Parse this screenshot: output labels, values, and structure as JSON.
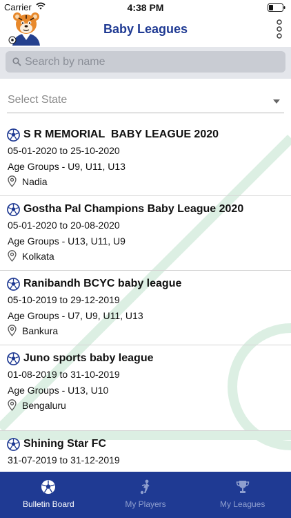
{
  "status_bar": {
    "carrier": "Carrier",
    "time": "4:38 PM"
  },
  "header": {
    "title": "Baby Leagues"
  },
  "search": {
    "placeholder": "Search by name"
  },
  "state_filter": {
    "label": "Select State"
  },
  "leagues": [
    {
      "name": "S R MEMORIAL  BABY LEAGUE 2020",
      "dates": "05-01-2020 to 25-10-2020",
      "age_groups": "Age Groups - U9, U11, U13",
      "location": "Nadia"
    },
    {
      "name": "Gostha Pal Champions Baby League 2020",
      "dates": "05-01-2020 to 20-08-2020",
      "age_groups": "Age Groups - U13, U11, U9",
      "location": "Kolkata"
    },
    {
      "name": "Ranibandh BCYC baby league",
      "dates": "05-10-2019 to 29-12-2019",
      "age_groups": "Age Groups - U7, U9, U11, U13",
      "location": "Bankura"
    },
    {
      "name": "Juno sports baby league",
      "dates": "01-08-2019 to 31-10-2019",
      "age_groups": "Age Groups - U13, U10",
      "location": "Bengaluru"
    },
    {
      "name": "Shining Star FC",
      "dates": "31-07-2019 to 31-12-2019"
    }
  ],
  "tabs": [
    {
      "label": "Bulletin Board",
      "icon": "soccer-ball-icon",
      "active": true
    },
    {
      "label": "My Players",
      "icon": "player-icon",
      "active": false
    },
    {
      "label": "My Leagues",
      "icon": "trophy-icon",
      "active": false
    }
  ],
  "colors": {
    "brand": "#1f3a93",
    "field_lines": "#dcefe3"
  }
}
